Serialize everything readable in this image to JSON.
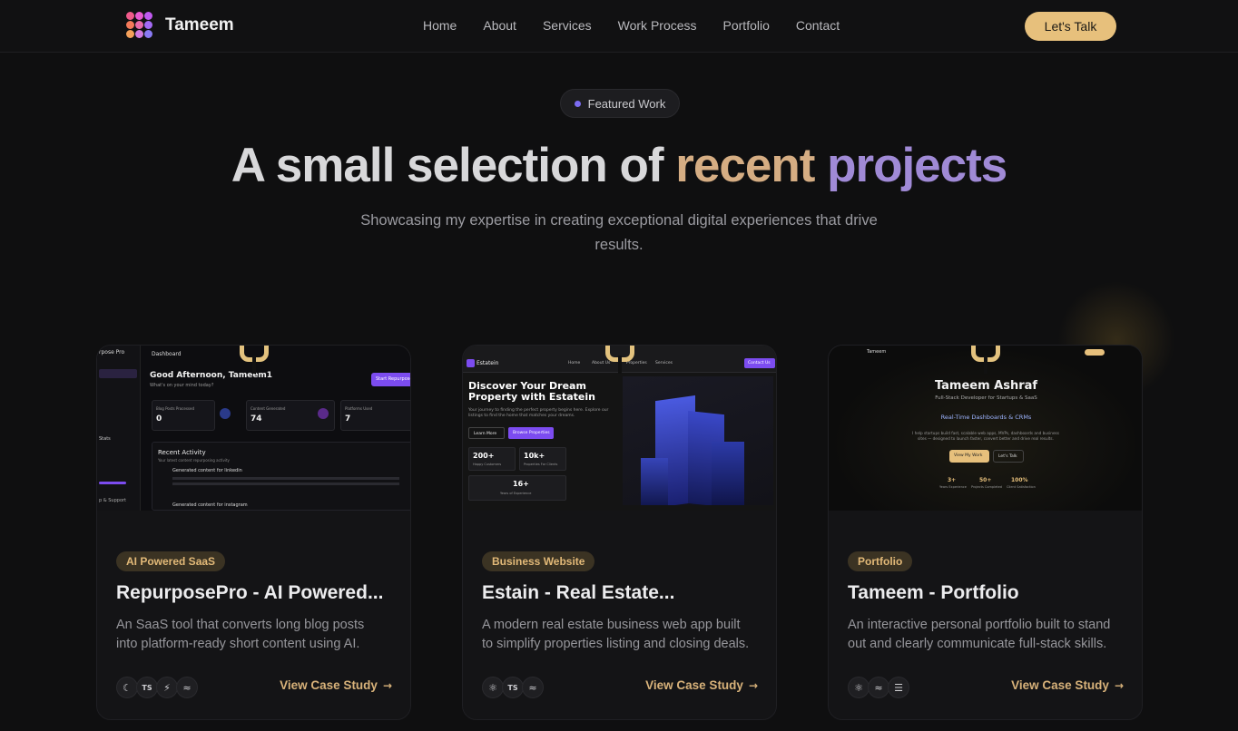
{
  "nav": {
    "brand": "Tameem",
    "links": [
      "Home",
      "About",
      "Services",
      "Work Process",
      "Portfolio",
      "Contact"
    ],
    "cta": "Let's Talk"
  },
  "hero": {
    "badge": "Featured Work",
    "headline_plain": "A small selection of",
    "headline_accent1": "recent",
    "headline_accent2": "projects",
    "subtitle": "Showcasing my expertise in creating exceptional digital experiences that drive results."
  },
  "projects": [
    {
      "tag": "AI Powered SaaS",
      "title": "RepurposePro - AI Powered...",
      "description": "An SaaS tool that converts long blog posts into platform-ready short content using AI.",
      "techs": [
        "moon-icon",
        "typescript-icon",
        "bolt-icon",
        "tailwind-icon"
      ],
      "tech_glyphs": [
        "☾",
        "TS",
        "⚡",
        "≈"
      ],
      "cta": "View Case Study",
      "preview": {
        "brand": "rpose Pro",
        "header": "Dashboard",
        "greeting": "Good Afternoon, Tameem1",
        "prompt": "What's on your mind today?",
        "button": "Start Repurpose",
        "stats": [
          {
            "label": "Blog Posts Processed",
            "value": "0"
          },
          {
            "label": "Content Generated",
            "value": "74"
          },
          {
            "label": "Platforms Used",
            "value": "7"
          }
        ],
        "activity_title": "Recent Activity",
        "activity_sub": "Your latest content repurposing activity",
        "activity_items": [
          "Generated content for linkedin",
          "Generated content for instagram"
        ],
        "side_title": "Stats",
        "side_footer": "p & Support"
      }
    },
    {
      "tag": "Business Website",
      "title": "Estain - Real Estate...",
      "description": "A modern real estate business web app built to simplify properties listing and closing deals.",
      "techs": [
        "react-icon",
        "typescript-icon",
        "tailwind-icon"
      ],
      "tech_glyphs": [
        "⚛",
        "TS",
        "≈"
      ],
      "cta": "View Case Study",
      "preview": {
        "brand": "Estatein",
        "nav": [
          "Home",
          "About Us",
          "Properties",
          "Services"
        ],
        "contact": "Contact Us",
        "hero_title": "Discover Your Dream Property with Estatein",
        "hero_text": "Your journey to finding the perfect property begins here. Explore our listings to find the home that matches your dreams.",
        "btn1": "Learn More",
        "btn2": "Browse Properties",
        "stats": [
          {
            "value": "200+",
            "label": "Happy Customers"
          },
          {
            "value": "10k+",
            "label": "Properties For Clients"
          },
          {
            "value": "16+",
            "label": "Years of Experience"
          }
        ]
      }
    },
    {
      "tag": "Portfolio",
      "title": "Tameem - Portfolio",
      "description": "An interactive personal portfolio built to stand out and clearly communicate full-stack skills.",
      "techs": [
        "react-icon",
        "tailwind-icon",
        "framer-icon"
      ],
      "tech_glyphs": [
        "⚛",
        "≈",
        "☰"
      ],
      "cta": "View Case Study",
      "preview": {
        "brand": "Tameem",
        "name": "Tameem Ashraf",
        "role": "Full-Stack Developer for Startups & SaaS",
        "highlight": "Real-Time Dashboards & CRMs",
        "text": "I help startups build fast, scalable web apps, MVPs, dashboards and business sites — designed to launch faster, convert better and drive real results.",
        "btn1": "View My Work",
        "btn2": "Let's Talk",
        "stats": [
          {
            "value": "3+",
            "label": "Years Experience"
          },
          {
            "value": "50+",
            "label": "Projects Completed"
          },
          {
            "value": "100%",
            "label": "Client Satisfaction"
          }
        ]
      }
    }
  ],
  "colors": {
    "accent_gold": "#e7c07c",
    "accent_purple": "#7c6cf2",
    "background": "#0f0f10"
  }
}
